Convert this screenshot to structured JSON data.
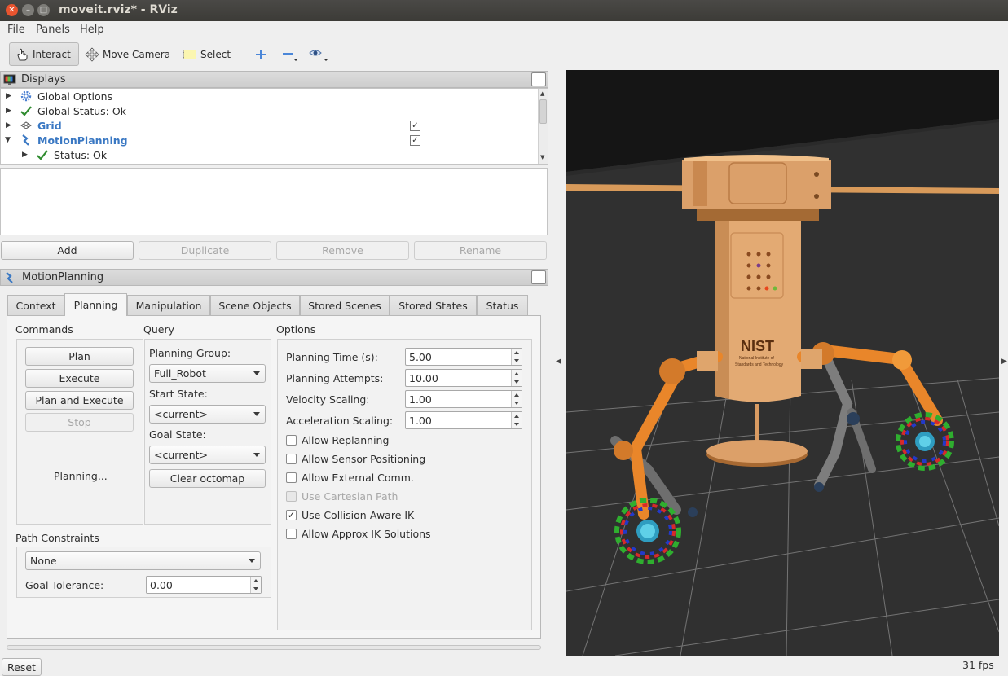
{
  "window": {
    "title": "moveit.rviz* - RViz"
  },
  "menu": {
    "file": "File",
    "panels": "Panels",
    "help": "Help"
  },
  "toolbar": {
    "interact": "Interact",
    "move_camera": "Move Camera",
    "select": "Select"
  },
  "displays": {
    "title": "Displays",
    "items": [
      {
        "label": "Global Options"
      },
      {
        "label": "Global Status: Ok"
      },
      {
        "label": "Grid",
        "checked": true
      },
      {
        "label": "MotionPlanning",
        "checked": true
      },
      {
        "label": "Status: Ok"
      }
    ],
    "buttons": {
      "add": "Add",
      "duplicate": "Duplicate",
      "remove": "Remove",
      "rename": "Rename"
    }
  },
  "motion_planning": {
    "title": "MotionPlanning",
    "tabs": [
      "Context",
      "Planning",
      "Manipulation",
      "Scene Objects",
      "Stored Scenes",
      "Stored States",
      "Status"
    ],
    "active_tab": "Planning",
    "commands": {
      "label": "Commands",
      "plan": "Plan",
      "execute": "Execute",
      "plan_and_execute": "Plan and Execute",
      "stop": "Stop",
      "status": "Planning..."
    },
    "query": {
      "label": "Query",
      "planning_group_label": "Planning Group:",
      "planning_group": "Full_Robot",
      "start_state_label": "Start State:",
      "start_state": "<current>",
      "goal_state_label": "Goal State:",
      "goal_state": "<current>",
      "clear_octomap": "Clear octomap"
    },
    "options": {
      "label": "Options",
      "planning_time_label": "Planning Time (s):",
      "planning_time": "5.00",
      "planning_attempts_label": "Planning Attempts:",
      "planning_attempts": "10.00",
      "velocity_scaling_label": "Velocity Scaling:",
      "velocity_scaling": "1.00",
      "acceleration_scaling_label": "Acceleration Scaling:",
      "acceleration_scaling": "1.00",
      "checkboxes": [
        {
          "label": "Allow Replanning",
          "checked": false,
          "enabled": true
        },
        {
          "label": "Allow Sensor Positioning",
          "checked": false,
          "enabled": true
        },
        {
          "label": "Allow External Comm.",
          "checked": false,
          "enabled": true
        },
        {
          "label": "Use Cartesian Path",
          "checked": false,
          "enabled": false
        },
        {
          "label": "Use Collision-Aware IK",
          "checked": true,
          "enabled": true
        },
        {
          "label": "Allow Approx IK Solutions",
          "checked": false,
          "enabled": true
        }
      ]
    },
    "path_constraints": {
      "label": "Path Constraints",
      "value": "None",
      "goal_tolerance_label": "Goal Tolerance:",
      "goal_tolerance": "0.00"
    }
  },
  "footer": {
    "reset": "Reset",
    "fps": "31 fps"
  },
  "viewport": {
    "logo": "NIST",
    "logo_subtitle_1": "National Institute of",
    "logo_subtitle_2": "Standards and Technology"
  }
}
